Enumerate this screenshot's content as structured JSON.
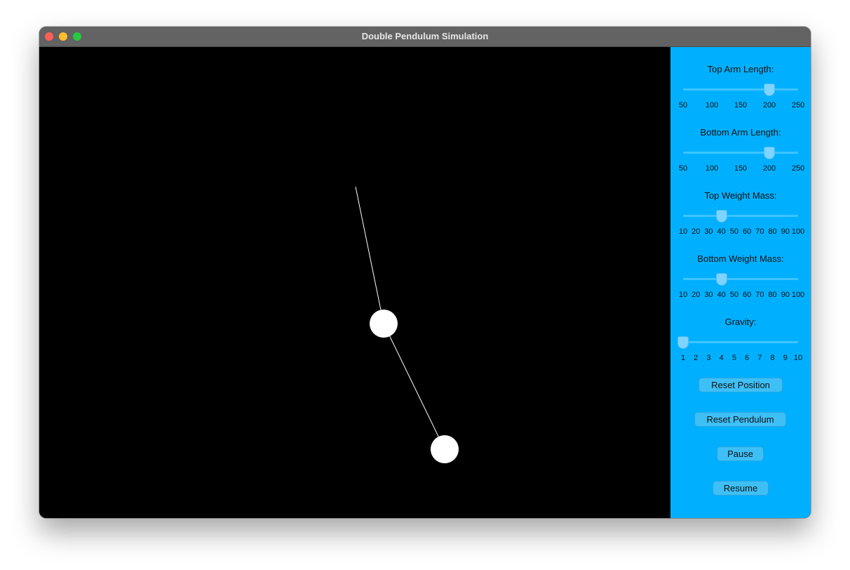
{
  "window": {
    "title": "Double Pendulum Simulation"
  },
  "colors": {
    "panel": "#00b0ff",
    "canvas": "#000000",
    "pendulum": "#ffffff"
  },
  "sliders": [
    {
      "label": "Top Arm Length:",
      "value": 200,
      "min": 50,
      "max": 250,
      "ticks": [
        "50",
        "100",
        "150",
        "200",
        "250"
      ]
    },
    {
      "label": "Bottom Arm Length:",
      "value": 200,
      "min": 50,
      "max": 250,
      "ticks": [
        "50",
        "100",
        "150",
        "200",
        "250"
      ]
    },
    {
      "label": "Top Weight Mass:",
      "value": 40,
      "min": 10,
      "max": 100,
      "ticks": [
        "10",
        "20",
        "30",
        "40",
        "50",
        "60",
        "70",
        "80",
        "90",
        "100"
      ]
    },
    {
      "label": "Bottom Weight Mass:",
      "value": 40,
      "min": 10,
      "max": 100,
      "ticks": [
        "10",
        "20",
        "30",
        "40",
        "50",
        "60",
        "70",
        "80",
        "90",
        "100"
      ]
    },
    {
      "label": "Gravity:",
      "value": 1,
      "min": 1,
      "max": 10,
      "ticks": [
        "1",
        "2",
        "3",
        "4",
        "5",
        "6",
        "7",
        "8",
        "9",
        "10"
      ]
    }
  ],
  "buttons": {
    "reset_position": "Reset Position",
    "reset_pendulum": "Reset Pendulum",
    "pause": "Pause",
    "resume": "Resume"
  }
}
